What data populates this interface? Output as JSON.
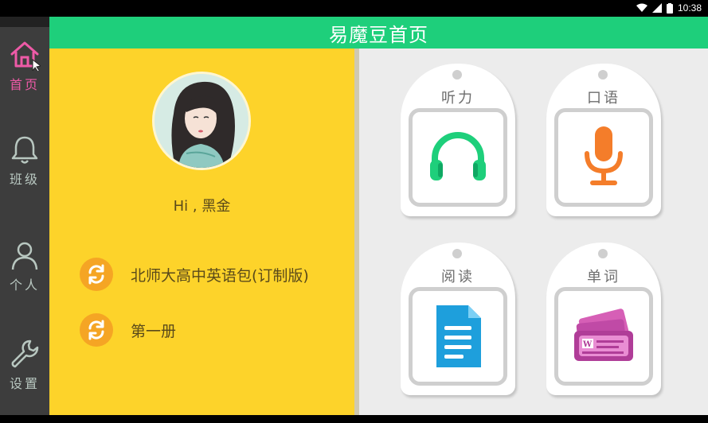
{
  "status_bar": {
    "time": "10:38"
  },
  "header": {
    "title": "易魔豆首页"
  },
  "nav": {
    "items": [
      {
        "label": "首页",
        "icon": "home-icon",
        "active": true
      },
      {
        "label": "班级",
        "icon": "bell-icon",
        "active": false
      },
      {
        "label": "个人",
        "icon": "person-icon",
        "active": false
      },
      {
        "label": "设置",
        "icon": "wrench-icon",
        "active": false
      }
    ]
  },
  "profile": {
    "greeting": "Hi , 黑金",
    "books": [
      {
        "label": "北师大高中英语包(订制版)",
        "icon": "refresh-icon"
      },
      {
        "label": "第一册",
        "icon": "refresh-icon"
      }
    ]
  },
  "cards": [
    {
      "label": "听力",
      "icon": "headphones-icon"
    },
    {
      "label": "口语",
      "icon": "microphone-icon"
    },
    {
      "label": "阅读",
      "icon": "document-icon"
    },
    {
      "label": "单词",
      "icon": "word-cards-icon"
    }
  ],
  "colors": {
    "header_green": "#1ecf7b",
    "panel_yellow": "#fdd32a",
    "nav_active_pink": "#ee5aa7",
    "refresh_orange": "#f5a524"
  }
}
